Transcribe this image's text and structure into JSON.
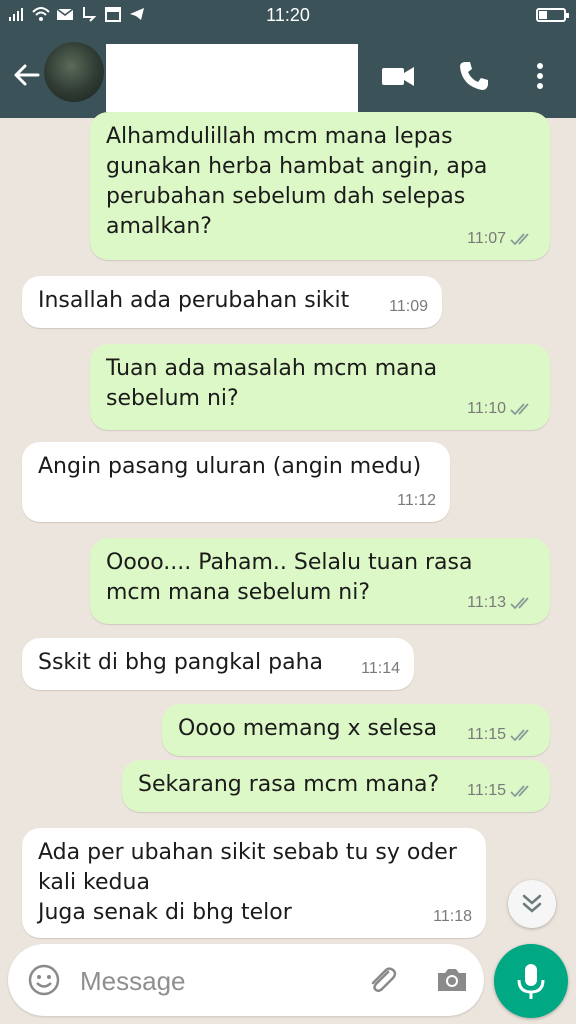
{
  "status_bar": {
    "time": "11:20"
  },
  "messages": [
    {
      "direction": "out",
      "text": "Alhamdulillah mcm mana lepas\ngunakan herba hambat angin, apa\nperubahan sebelum dah selepas\namalkan?",
      "time": "11:07",
      "read": true
    },
    {
      "direction": "in",
      "text": "Insallah ada perubahan sikit",
      "time": "11:09"
    },
    {
      "direction": "out",
      "text": "Tuan ada masalah mcm mana\nsebelum ni?",
      "time": "11:10",
      "read": true
    },
    {
      "direction": "in",
      "text": "Angin pasang uluran (angin medu)",
      "time": "11:12"
    },
    {
      "direction": "out",
      "text": "Oooo....  Paham..  Selalu tuan rasa\nmcm mana sebelum ni?",
      "time": "11:13",
      "read": true
    },
    {
      "direction": "in",
      "text": "Sskit di bhg pangkal paha",
      "time": "11:14"
    },
    {
      "direction": "out",
      "text": "Oooo memang x selesa",
      "time": "11:15",
      "read": true
    },
    {
      "direction": "out",
      "text": "Sekarang rasa mcm mana?",
      "time": "11:15",
      "read": true
    },
    {
      "direction": "in",
      "text": "Ada per ubahan sikit sebab tu sy oder\nkali kedua\nJuga senak di bhg telor",
      "time": "11:18"
    }
  ],
  "input": {
    "placeholder": "Message"
  },
  "colors": {
    "header": "#3b5259",
    "chat_background": "#ece5dd",
    "outgoing_bubble": "#dcf8c6",
    "incoming_bubble": "#ffffff",
    "accent": "#00a884",
    "read_ticks": "#8a9a9a"
  },
  "icons": {
    "back": "arrow-left-icon",
    "video": "video-call-icon",
    "call": "phone-icon",
    "menu": "more-vert-icon",
    "scroll": "double-chevron-down-icon",
    "emoji": "emoji-icon",
    "attach": "paperclip-icon",
    "camera": "camera-icon",
    "mic": "microphone-icon"
  }
}
